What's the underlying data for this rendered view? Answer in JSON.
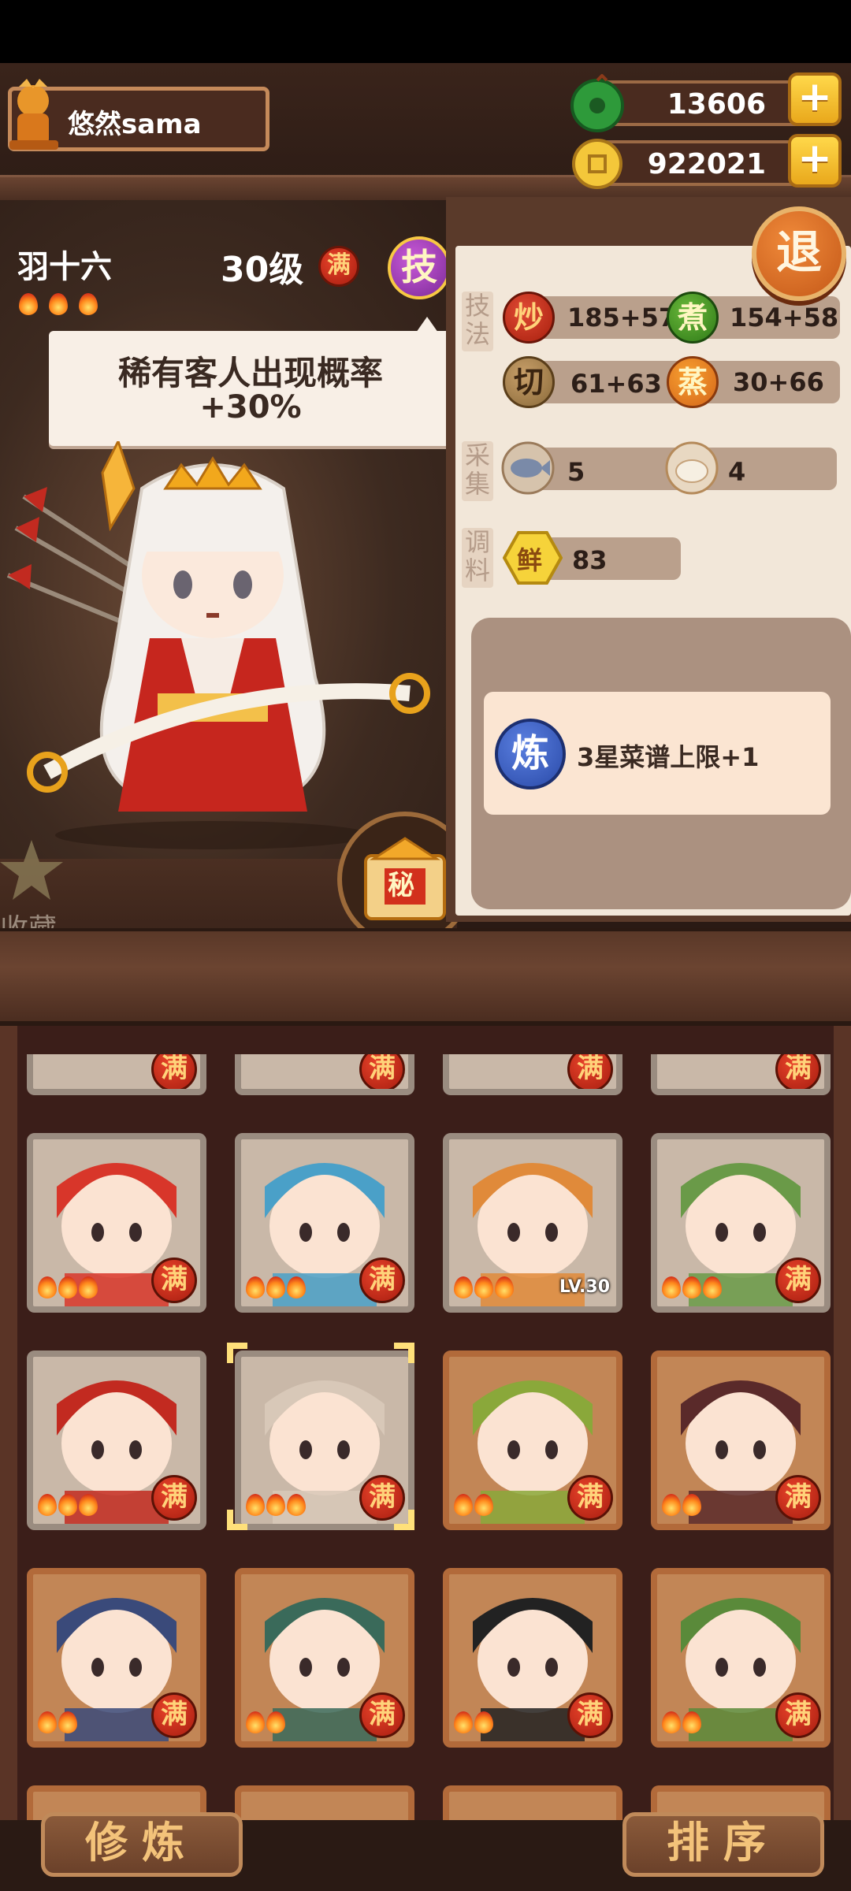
{
  "player": {
    "name": "悠然sama"
  },
  "currency": {
    "jade": "13606",
    "coins": "922021",
    "plus": "+"
  },
  "back_label": "退",
  "character": {
    "name": "羽十六",
    "level": "30级",
    "max_badge": "满",
    "skill_label": "技",
    "stars": 3,
    "tooltip_line1": "稀有客人出现概率",
    "tooltip_line2": "+30%",
    "favorite_label": "收藏",
    "gift_label": "秘"
  },
  "stats": {
    "technique_label": "技法",
    "gather_label": "采集",
    "seasoning_label": "调料",
    "stir_fry": {
      "icon": "炒",
      "value": "185+57"
    },
    "boil": {
      "icon": "煮",
      "value": "154+58"
    },
    "cut": {
      "icon": "切",
      "value": "61+63"
    },
    "steam": {
      "icon": "蒸",
      "value": "30+66"
    },
    "fish": {
      "value": "5"
    },
    "flour": {
      "value": "4"
    },
    "fresh": {
      "icon": "鲜",
      "value": "83"
    }
  },
  "refine": {
    "icon": "炼",
    "text": "3星菜谱上限+1"
  },
  "roster": {
    "man": "满",
    "lv30": "LV.30",
    "cards": [
      {
        "flames": 3,
        "badge": "man",
        "style": "grey",
        "color": "#d8362a"
      },
      {
        "flames": 3,
        "badge": "man",
        "style": "grey",
        "color": "#4aa0c8"
      },
      {
        "flames": 3,
        "badge": "lv",
        "style": "grey",
        "color": "#e08a3a"
      },
      {
        "flames": 3,
        "badge": "man",
        "style": "grey",
        "color": "#6a9a48"
      },
      {
        "flames": 3,
        "badge": "man",
        "style": "grey",
        "color": "#c22a20"
      },
      {
        "flames": 3,
        "badge": "man",
        "style": "grey",
        "color": "#d8c8b8",
        "selected": true
      },
      {
        "flames": 2,
        "badge": "man",
        "style": "gold",
        "color": "#8aa83a"
      },
      {
        "flames": 2,
        "badge": "man",
        "style": "gold",
        "color": "#5a2a2a"
      },
      {
        "flames": 2,
        "badge": "man",
        "style": "gold",
        "color": "#3a4a7a"
      },
      {
        "flames": 2,
        "badge": "man",
        "style": "gold",
        "color": "#3a6a5a"
      },
      {
        "flames": 2,
        "badge": "man",
        "style": "gold",
        "color": "#222222"
      },
      {
        "flames": 2,
        "badge": "man",
        "style": "gold",
        "color": "#5a8a3a"
      }
    ]
  },
  "buttons": {
    "train": "修炼",
    "sort": "排序"
  },
  "colors": {
    "panel_bg": "#3b1e19",
    "badge_red": "#c22a18",
    "gold": "#f7c843"
  }
}
